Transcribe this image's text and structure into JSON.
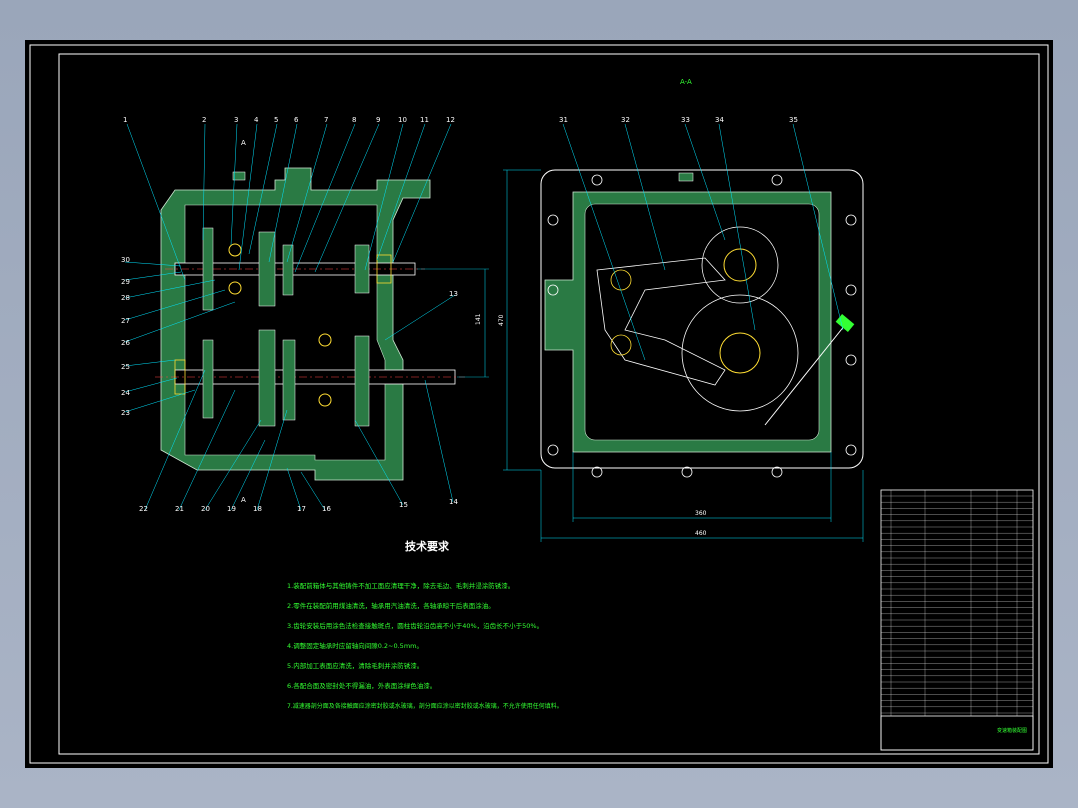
{
  "section_label": "A-A",
  "notes": {
    "title": "技术要求",
    "items": [
      "1.装配前箱体与其他铸件不加工面应清理干净，除去毛边、毛刺并浸涂防锈漆。",
      "2.零件在装配前用煤油清洗，轴承用汽油清洗，各轴承晾干后表面涂油。",
      "3.齿轮安装后用涂色法检查接触斑点，圆柱齿轮沿齿高不小于40%，沿齿长不小于50%。",
      "4.调整固定轴承时应留轴向间隙0.2~0.5mm。",
      "5.内部加工表面应清洗，清除毛刺并涂防锈漆。",
      "6.各配合面及密封处不得漏油，外表面涂绿色油漆。",
      "7.减速器剖分面及各接触面应涂密封胶或水玻璃，剖分面应涂以密封胶或水玻璃，不允许使用任何填料。"
    ]
  },
  "left_view": {
    "top_labels": [
      "1",
      "2",
      "3",
      "4",
      "5",
      "6",
      "7",
      "8",
      "9",
      "10",
      "11",
      "12"
    ],
    "left_labels": [
      "30",
      "29",
      "28",
      "27",
      "26",
      "25",
      "24",
      "23"
    ],
    "bottom_labels": [
      "22",
      "21",
      "20",
      "19",
      "18",
      "17",
      "16",
      "15",
      "14"
    ],
    "right_labels": [
      "13"
    ],
    "dimension": "141"
  },
  "right_view": {
    "top_labels": [
      "31",
      "32",
      "33",
      "34",
      "35"
    ],
    "dim_height": "470",
    "dim_inner": "360",
    "dim_outer": "460"
  },
  "title_block": {
    "drawing_title": "变速箱装配图"
  },
  "colors": {
    "background": "#000000",
    "housing": "#2a7a44",
    "line": "#ffffff",
    "accent": "#33ff33",
    "leader": "#00e5ff"
  }
}
